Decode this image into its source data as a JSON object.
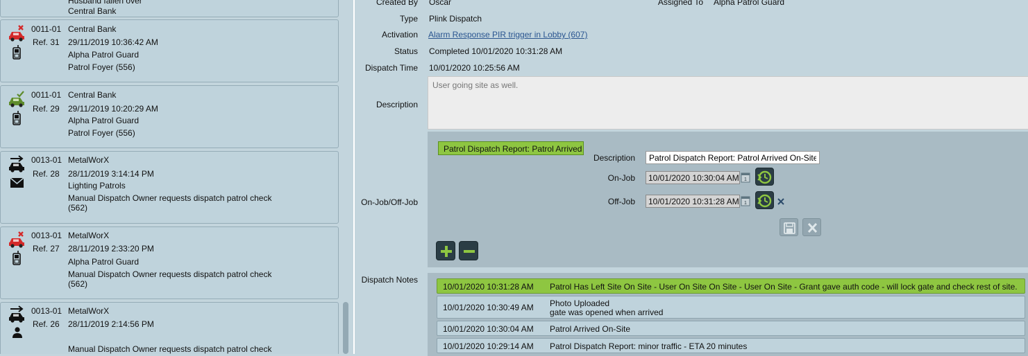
{
  "dispatch_list": [
    {
      "code": "",
      "ref": "",
      "name": "Central Bank",
      "timestamp": "",
      "line3": "",
      "line4_prefix": "Husband fallen over",
      "status_icon": "none",
      "contact_icon": "none"
    },
    {
      "code": "0011-01",
      "ref": "Ref. 31",
      "name": "Central Bank",
      "timestamp": "29/11/2019 10:36:42 AM",
      "line3": "Alpha Patrol Guard",
      "line4": "Patrol Foyer (556)",
      "line5": "",
      "status_icon": "car-cancelled-icon",
      "contact_icon": "mobile-phone-icon"
    },
    {
      "code": "0011-01",
      "ref": "Ref. 29",
      "name": "Central Bank",
      "timestamp": "29/11/2019 10:20:29 AM",
      "line3": "Alpha Patrol Guard",
      "line4": "Patrol Foyer (556)",
      "line5": "",
      "status_icon": "car-completed-icon",
      "contact_icon": "mobile-phone-icon"
    },
    {
      "code": "0013-01",
      "ref": "Ref. 28",
      "name": "MetalWorX",
      "timestamp": "28/11/2019 3:14:14 PM",
      "line3": "Lighting Patrols",
      "line4": "Manual Dispatch  Owner requests dispatch patrol check",
      "line5": "(562)",
      "status_icon": "car-dispatched-icon",
      "contact_icon": "envelope-icon"
    },
    {
      "code": "0013-01",
      "ref": "Ref. 27",
      "name": "MetalWorX",
      "timestamp": "28/11/2019 2:33:20 PM",
      "line3": "Alpha Patrol Guard",
      "line4": "Manual Dispatch  Owner requests dispatch patrol check",
      "line5": "(562)",
      "status_icon": "car-cancelled-icon",
      "contact_icon": "mobile-phone-icon"
    },
    {
      "code": "0013-01",
      "ref": "Ref. 26",
      "name": "MetalWorX",
      "timestamp": "28/11/2019 2:14:56 PM",
      "line3": "",
      "line4": "Manual Dispatch  Owner requests dispatch patrol check",
      "line5": "",
      "status_icon": "car-dispatched-icon",
      "contact_icon": "person-icon"
    }
  ],
  "details": {
    "created_by_label": "Created By",
    "created_by_value": "Oscar",
    "assigned_to_label": "Assigned To",
    "assigned_to_value": "Alpha Patrol Guard",
    "type_label": "Type",
    "type_value": "Plink Dispatch",
    "activation_label": "Activation",
    "activation_value": "Alarm Response  PIR trigger in Lobby (607)",
    "status_label": "Status",
    "status_value": "Completed  10/01/2020 10:31:28 AM",
    "dispatch_time_label": "Dispatch Time",
    "dispatch_time_value": "10/01/2020 10:25:56 AM",
    "description_label": "Description",
    "description_value": "User going site as well.",
    "onjob_offjob_label": "On-Job/Off-Job",
    "dispatch_notes_label": "Dispatch Notes"
  },
  "job_panel": {
    "report_tab": "Patrol Dispatch Report: Patrol Arrived On-Site",
    "description_label": "Description",
    "description_value": "Patrol Dispatch Report: Patrol Arrived On-Site",
    "on_job_label": "On-Job",
    "on_job_value": "10/01/2020 10:30:04 AM",
    "off_job_label": "Off-Job",
    "off_job_value": "10/01/2020 10:31:28 AM"
  },
  "notes": [
    {
      "time": "10/01/2020 10:31:28 AM",
      "message": "Patrol Has Left Site On Site - User On Site On Site - User On Site - Grant gave auth code - will lock gate and check rest of site.",
      "message2": "",
      "active": true
    },
    {
      "time": "10/01/2020 10:30:49 AM",
      "message": "Photo Uploaded",
      "message2": "gate was opened when arrived",
      "active": false
    },
    {
      "time": "10/01/2020 10:30:04 AM",
      "message": "Patrol Arrived On-Site",
      "message2": "",
      "active": false
    },
    {
      "time": "10/01/2020 10:29:14 AM",
      "message": "Patrol Dispatch Report:  minor traffic - ETA 20 minutes",
      "message2": "",
      "active": false
    }
  ],
  "colors": {
    "background": "#c3d5dd",
    "accent_green": "#8ec641",
    "cancel_red": "#d42a2a",
    "complete_green": "#5e8c2c",
    "link_blue": "#2a5590"
  }
}
